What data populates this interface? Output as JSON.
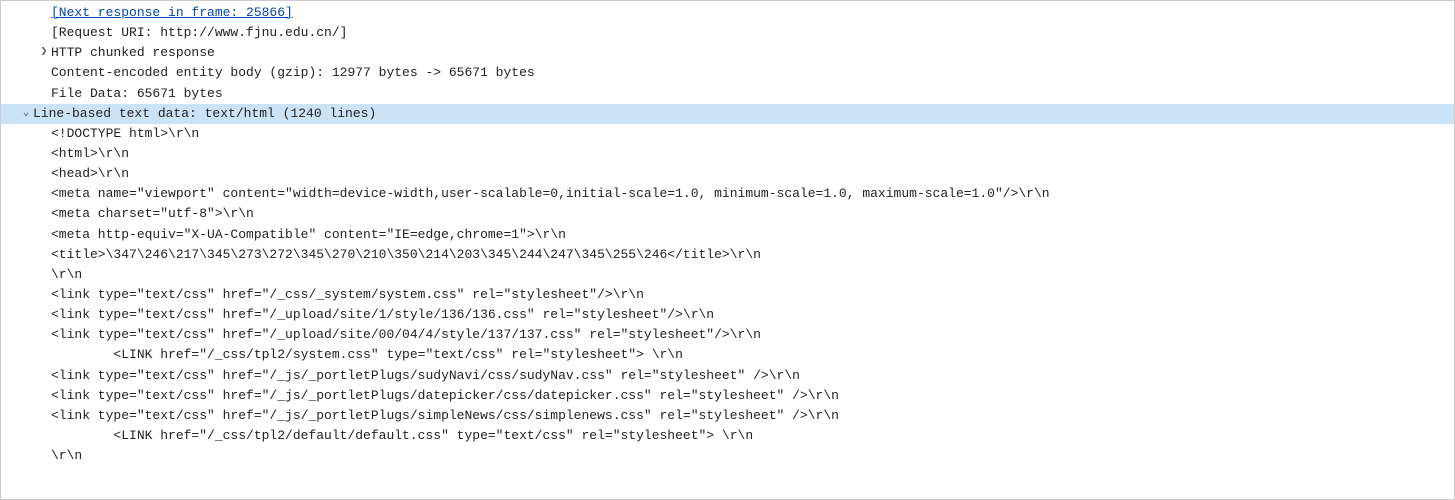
{
  "header_lines": [
    {
      "type": "link",
      "text": "[Next response in frame: 25866]",
      "indent": "pad1b",
      "arrow": ""
    },
    {
      "type": "plain",
      "text": "[Request URI: http://www.fjnu.edu.cn/]",
      "indent": "pad1b",
      "arrow": ""
    },
    {
      "type": "plain",
      "text": "HTTP chunked response",
      "indent": "pad1",
      "arrow": "right"
    },
    {
      "type": "plain",
      "text": "Content-encoded entity body (gzip): 12977 bytes -> 65671 bytes",
      "indent": "pad1b",
      "arrow": ""
    },
    {
      "type": "plain",
      "text": "File Data: 65671 bytes",
      "indent": "pad1b",
      "arrow": ""
    }
  ],
  "section_header": "Line-based text data: text/html (1240 lines)",
  "body_lines": [
    "<!DOCTYPE html>\\r\\n",
    "<html>\\r\\n",
    "<head>\\r\\n",
    "<meta name=\"viewport\" content=\"width=device-width,user-scalable=0,initial-scale=1.0, minimum-scale=1.0, maximum-scale=1.0\"/>\\r\\n",
    "<meta charset=\"utf-8\">\\r\\n",
    "<meta http-equiv=\"X-UA-Compatible\" content=\"IE=edge,chrome=1\">\\r\\n",
    "<title>\\347\\246\\217\\345\\273\\272\\345\\270\\210\\350\\214\\203\\345\\244\\247\\345\\255\\246</title>\\r\\n",
    "\\r\\n",
    "<link type=\"text/css\" href=\"/_css/_system/system.css\" rel=\"stylesheet\"/>\\r\\n",
    "<link type=\"text/css\" href=\"/_upload/site/1/style/136/136.css\" rel=\"stylesheet\"/>\\r\\n",
    "<link type=\"text/css\" href=\"/_upload/site/00/04/4/style/137/137.css\" rel=\"stylesheet\"/>\\r\\n",
    "        <LINK href=\"/_css/tpl2/system.css\" type=\"text/css\" rel=\"stylesheet\"> \\r\\n",
    "<link type=\"text/css\" href=\"/_js/_portletPlugs/sudyNavi/css/sudyNav.css\" rel=\"stylesheet\" />\\r\\n",
    "<link type=\"text/css\" href=\"/_js/_portletPlugs/datepicker/css/datepicker.css\" rel=\"stylesheet\" />\\r\\n",
    "<link type=\"text/css\" href=\"/_js/_portletPlugs/simpleNews/css/simplenews.css\" rel=\"stylesheet\" />\\r\\n",
    "        <LINK href=\"/_css/tpl2/default/default.css\" type=\"text/css\" rel=\"stylesheet\"> \\r\\n",
    "\\r\\n"
  ]
}
